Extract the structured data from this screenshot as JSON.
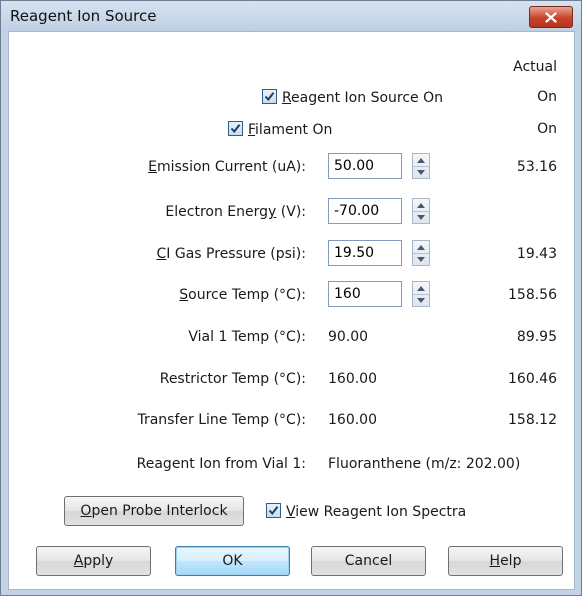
{
  "window": {
    "title": "Reagent Ion Source"
  },
  "header": {
    "actual_label": "Actual"
  },
  "checks": {
    "reagent_ion_source_on": {
      "prefix": "",
      "mnemonic": "R",
      "suffix": "eagent Ion Source On",
      "checked": true,
      "actual": "On"
    },
    "filament_on": {
      "prefix": "",
      "mnemonic": "F",
      "suffix": "ilament On",
      "checked": true,
      "actual": "On"
    }
  },
  "fields": {
    "emission_current": {
      "prefix": "",
      "mnemonic": "E",
      "suffix": "mission Current (uA):",
      "value": "50.00",
      "actual": "53.16"
    },
    "electron_energy": {
      "prefix": "Electron Energ",
      "mnemonic": "y",
      "suffix": " (V):",
      "value": "-70.00",
      "actual": ""
    },
    "ci_gas_pressure": {
      "prefix": "",
      "mnemonic": "C",
      "suffix": "I Gas Pressure (psi):",
      "value": "19.50",
      "actual": "19.43"
    },
    "source_temp": {
      "prefix": "",
      "mnemonic": "S",
      "suffix": "ource Temp (°C):",
      "value": "160",
      "actual": "158.56"
    }
  },
  "readouts": {
    "vial1_temp": {
      "label": "Vial 1 Temp (°C):",
      "setpoint": "90.00",
      "actual": "89.95"
    },
    "restrictor_temp": {
      "label": "Restrictor Temp (°C):",
      "setpoint": "160.00",
      "actual": "160.46"
    },
    "transfer_line_temp": {
      "label": "Transfer Line Temp (°C):",
      "setpoint": "160.00",
      "actual": "158.12"
    },
    "reagent_ion": {
      "label": "Reagent Ion from Vial 1:",
      "value": "Fluoranthene (m/z: 202.00)"
    }
  },
  "probe": {
    "button": {
      "mnemonic": "O",
      "suffix": "pen Probe Interlock"
    },
    "view_spectra": {
      "prefix": "",
      "mnemonic": "V",
      "suffix": "iew Reagent Ion Spectra",
      "checked": true
    }
  },
  "buttons": {
    "apply": {
      "mnemonic": "A",
      "suffix": "pply"
    },
    "ok": "OK",
    "cancel": "Cancel",
    "help": {
      "mnemonic": "H",
      "suffix": "elp"
    }
  },
  "colors": {
    "window_frame": "#c3d3e5",
    "close_button": "#c7442b",
    "checkbox_border": "#2f5d8a"
  }
}
